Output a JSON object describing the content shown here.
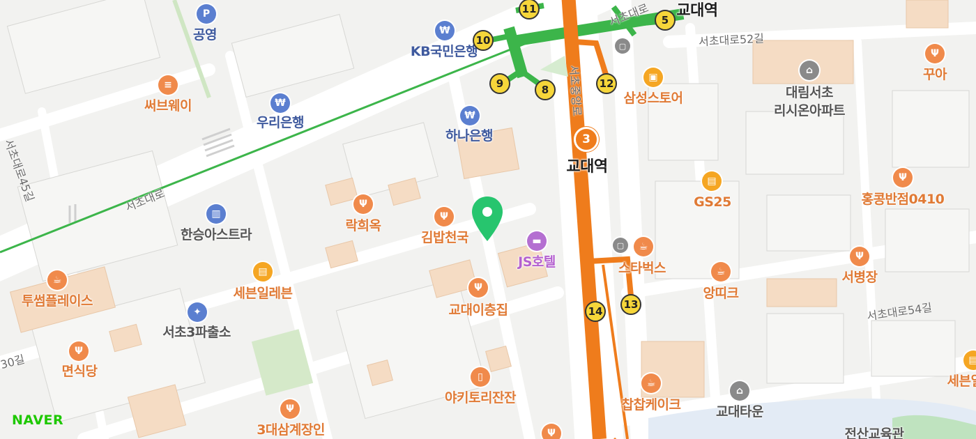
{
  "map": {
    "brand": "NAVER",
    "places": [
      {
        "id": "parking",
        "name": "공영",
        "icon": "parking-icon",
        "kind": "blue",
        "glyph": "P"
      },
      {
        "id": "kb",
        "name": "KB국민은행",
        "icon": "bank-icon",
        "kind": "blue",
        "glyph": "₩"
      },
      {
        "id": "subway",
        "name": "써브웨이",
        "icon": "burger-icon",
        "kind": "orange",
        "glyph": "≡"
      },
      {
        "id": "woori",
        "name": "우리은행",
        "icon": "bank-icon",
        "kind": "blue",
        "glyph": "₩"
      },
      {
        "id": "hana",
        "name": "하나은행",
        "icon": "bank-icon",
        "kind": "blue",
        "glyph": "₩"
      },
      {
        "id": "samsung",
        "name": "삼성스토어",
        "icon": "store-icon",
        "kind": "yellow",
        "glyph": "▣"
      },
      {
        "id": "daerim",
        "name": "대림서초\n리시온아파트",
        "icon": "building-icon",
        "kind": "gray",
        "glyph": "⌂"
      },
      {
        "id": "kkua",
        "name": "꾸아",
        "icon": "restaurant-icon",
        "kind": "orange",
        "glyph": "Ψ"
      },
      {
        "id": "gs25",
        "name": "GS25",
        "icon": "convenience-store-icon",
        "kind": "yellow",
        "glyph": "▤"
      },
      {
        "id": "hongkong",
        "name": "홍콩반점0410",
        "icon": "restaurant-icon",
        "kind": "orange",
        "glyph": "Ψ"
      },
      {
        "id": "hanseung",
        "name": "한승아스트라",
        "icon": "apartment-icon",
        "kind": "blue",
        "glyph": "▥"
      },
      {
        "id": "rakhee",
        "name": "락희옥",
        "icon": "restaurant-icon",
        "kind": "orange",
        "glyph": "Ψ"
      },
      {
        "id": "kimbap",
        "name": "김밥천국",
        "icon": "restaurant-icon",
        "kind": "orange",
        "glyph": "Ψ"
      },
      {
        "id": "jshotel",
        "name": "JS호텔",
        "icon": "hotel-icon",
        "kind": "purple",
        "glyph": "▬"
      },
      {
        "id": "starbucks",
        "name": "스타벅스",
        "icon": "cafe-icon",
        "kind": "orange",
        "glyph": "☕"
      },
      {
        "id": "anttique",
        "name": "앙띠크",
        "icon": "cafe-icon",
        "kind": "orange",
        "glyph": "☕"
      },
      {
        "id": "seobyeong",
        "name": "서병장",
        "icon": "restaurant-icon",
        "kind": "orange",
        "glyph": "Ψ"
      },
      {
        "id": "tosome",
        "name": "투썸플레이스",
        "icon": "cafe-icon",
        "kind": "orange",
        "glyph": "☕"
      },
      {
        "id": "seven1",
        "name": "세븐일레븐",
        "icon": "convenience-store-icon",
        "kind": "yellow",
        "glyph": "▤"
      },
      {
        "id": "police",
        "name": "서초3파출소",
        "icon": "police-icon",
        "kind": "blue",
        "glyph": "✦"
      },
      {
        "id": "gyodae2",
        "name": "교대이층집",
        "icon": "restaurant-icon",
        "kind": "orange",
        "glyph": "Ψ"
      },
      {
        "id": "myeonsik",
        "name": "면식당",
        "icon": "restaurant-icon",
        "kind": "orange",
        "glyph": "Ψ"
      },
      {
        "id": "yakitori",
        "name": "야키토리잔잔",
        "icon": "beer-icon",
        "kind": "orange",
        "glyph": "▯"
      },
      {
        "id": "samgye",
        "name": "3대삼계장인",
        "icon": "restaurant-icon",
        "kind": "orange",
        "glyph": "Ψ"
      },
      {
        "id": "chapchap",
        "name": "찹찹케이크",
        "icon": "cafe-icon",
        "kind": "orange",
        "glyph": "☕"
      },
      {
        "id": "gyodaetown",
        "name": "교대타운",
        "icon": "building-icon",
        "kind": "gray",
        "glyph": "⌂"
      },
      {
        "id": "seven2",
        "name": "세븐일",
        "icon": "convenience-store-icon",
        "kind": "yellow",
        "glyph": "▤"
      },
      {
        "id": "edu",
        "name": "전산교육관",
        "icon": "none",
        "kind": "none",
        "glyph": ""
      }
    ],
    "stations": [
      {
        "id": "gyodae-top",
        "name": "교대역"
      },
      {
        "id": "gyodae-main",
        "name": "교대역",
        "line_badge": "3"
      }
    ],
    "roads": [
      {
        "id": "seocho-daero",
        "name": "서초대로"
      },
      {
        "id": "seocho-daero-45",
        "name": "서초대로45길"
      },
      {
        "id": "seocho-daero-52",
        "name": "서초대로52길"
      },
      {
        "id": "seocho-daero-54",
        "name": "서초대로54길"
      },
      {
        "id": "seocho-jungang",
        "name": "서초중앙로"
      },
      {
        "id": "seocho-top",
        "name": "서초대로"
      },
      {
        "id": "road-30",
        "name": "30길"
      }
    ],
    "exits": [
      "11",
      "10",
      "9",
      "8",
      "5",
      "12",
      "14",
      "13"
    ],
    "colors": {
      "line2": "#3cb54a",
      "line3": "#ef7c1c",
      "pin": "#27c56e",
      "brand": "#1ec800"
    }
  }
}
